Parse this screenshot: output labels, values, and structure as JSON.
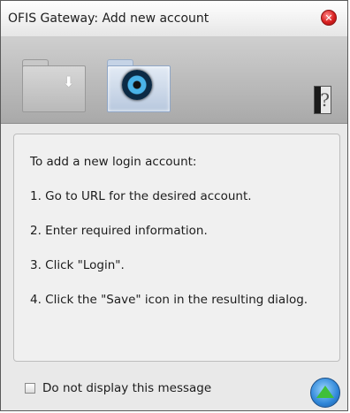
{
  "window": {
    "title": "OFIS Gateway: Add new account",
    "close_icon": "close-icon"
  },
  "toolbar": {
    "inbox_icon": "folder-download-icon",
    "active_icon": "folder-lens-icon",
    "help_label": "?"
  },
  "message": {
    "lines": [
      "To add a new login account:",
      "1. Go to URL for the desired account.",
      "2. Enter required information.",
      "3. Click \"Login\".",
      "4. Click the \"Save\" icon in the resulting dialog."
    ]
  },
  "footer": {
    "checkbox_label": "Do not display this message",
    "checkbox_checked": false,
    "up_icon": "up-arrow-icon"
  },
  "colors": {
    "accent": "#2f86d8",
    "close": "#d81f1f",
    "up_arrow": "#3fbf3a"
  }
}
